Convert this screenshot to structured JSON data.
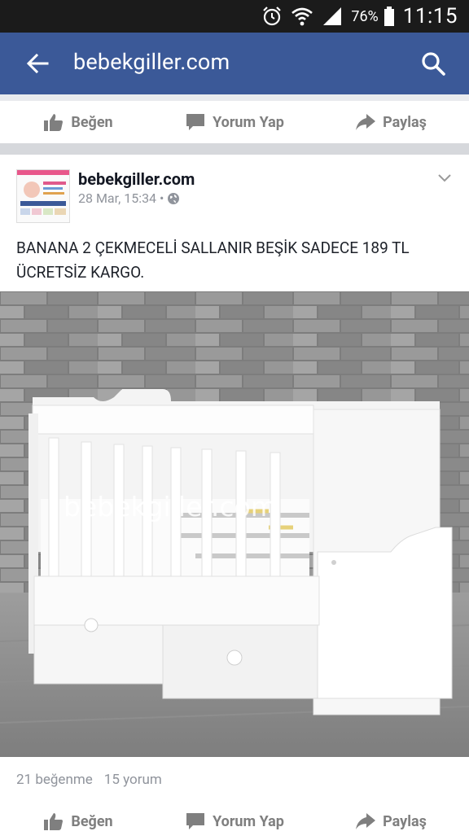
{
  "status": {
    "battery": "76%",
    "time": "11:15"
  },
  "appbar": {
    "title": "bebekgiller.com"
  },
  "actions": {
    "like": "Beğen",
    "comment": "Yorum Yap",
    "share": "Paylaş"
  },
  "post": {
    "page_name": "bebekgiller.com",
    "date": "28 Mar, 15:34",
    "separator": "•",
    "text": "BANANA 2 ÇEKMECELİ SALLANIR BEŞİK SADECE 189 TL ÜCRETSİZ KARGO.",
    "watermark": "bebekgiller.com",
    "likes": "21 beğenme",
    "comments": "15 yorum"
  },
  "colors": {
    "brand": "#3b5998",
    "statusbar": "#1b1b1b",
    "muted": "#90949c"
  }
}
